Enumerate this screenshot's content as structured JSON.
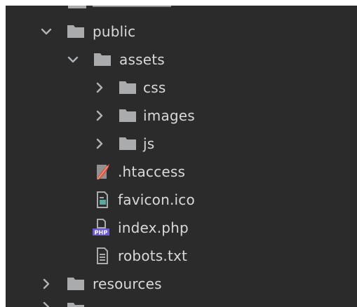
{
  "tree": {
    "items": [
      {
        "label": "public"
      },
      {
        "label": "assets"
      },
      {
        "label": "css"
      },
      {
        "label": "images"
      },
      {
        "label": "js"
      },
      {
        "label": ".htaccess"
      },
      {
        "label": "favicon.ico"
      },
      {
        "label": "index.php"
      },
      {
        "label": "robots.txt"
      },
      {
        "label": "resources"
      }
    ]
  },
  "icons": {
    "folder": "folder-icon",
    "htaccess": "htaccess-feather-icon",
    "ico": "image-file-icon",
    "php": "php-file-icon",
    "txt": "text-file-icon"
  },
  "colors": {
    "background": "#2b2b2b",
    "text": "#d9d9d9",
    "folder": "#a9abad",
    "chevron": "#b0b3b6",
    "php": "#6b5bd6"
  }
}
